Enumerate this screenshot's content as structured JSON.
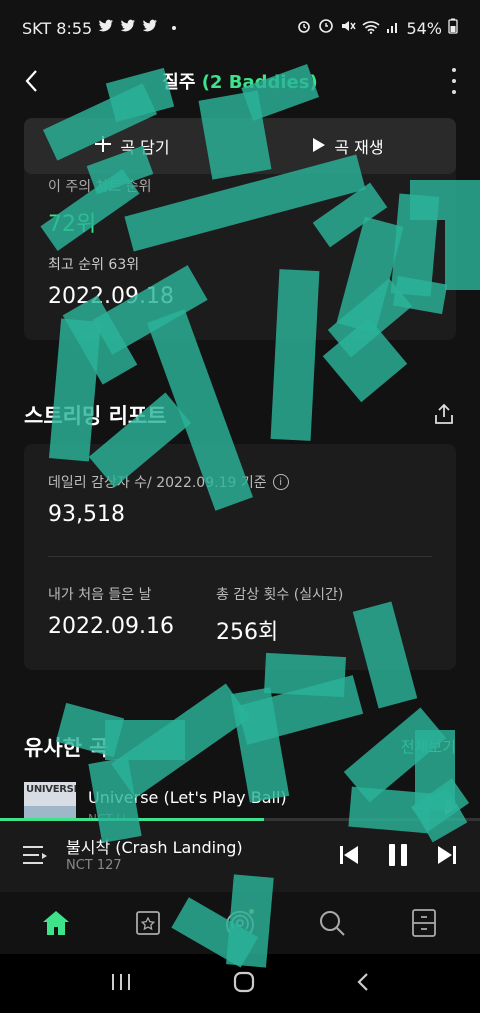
{
  "status_bar": {
    "carrier_time": "SKT 8:55",
    "battery": "54%",
    "notification_icons": [
      "twitter-icon",
      "twitter-icon",
      "twitter-icon",
      "dot-icon"
    ],
    "system_icons": [
      "alarm-icon",
      "clock-icon",
      "mute-icon",
      "wifi-icon",
      "signal-icon",
      "battery-icon"
    ]
  },
  "header": {
    "title_main": "질주",
    "title_sub": "(2 Baddies)"
  },
  "actions": {
    "add_label": "곡 담기",
    "play_label": "곡 재생"
  },
  "chart_card": {
    "weekly_label": "이 주의 차트 순위",
    "current_rank": "72위",
    "peak_label": "최고 순위 63위",
    "peak_date": "2022.09.18"
  },
  "streaming": {
    "title": "스트리밍 리포트",
    "daily_label": "데일리 감상자 수/ 2022.09.19 기준",
    "daily_value": "93,518",
    "first_listen_label": "내가 처음 들은 날",
    "first_listen_value": "2022.09.16",
    "total_label": "총 감상 횟수 (실시간)",
    "total_value": "256회"
  },
  "similar": {
    "title": "유사한 곡",
    "see_all": "전체보기",
    "items": [
      {
        "song": "Universe (Let's Play Ball)",
        "artist": "NCT U",
        "cover_text": "UNIVERSE"
      }
    ]
  },
  "player": {
    "song": "불시착 (Crash Landing)",
    "artist": "NCT 127",
    "progress": 0.55
  },
  "bottom_nav": [
    "home-icon",
    "storage-icon",
    "podcast-icon",
    "search-icon",
    "menu-icon"
  ],
  "colors": {
    "accent": "#3ee28a",
    "background": "#121212",
    "card": "#1c1c1c",
    "scribble": "#2bb39a"
  }
}
